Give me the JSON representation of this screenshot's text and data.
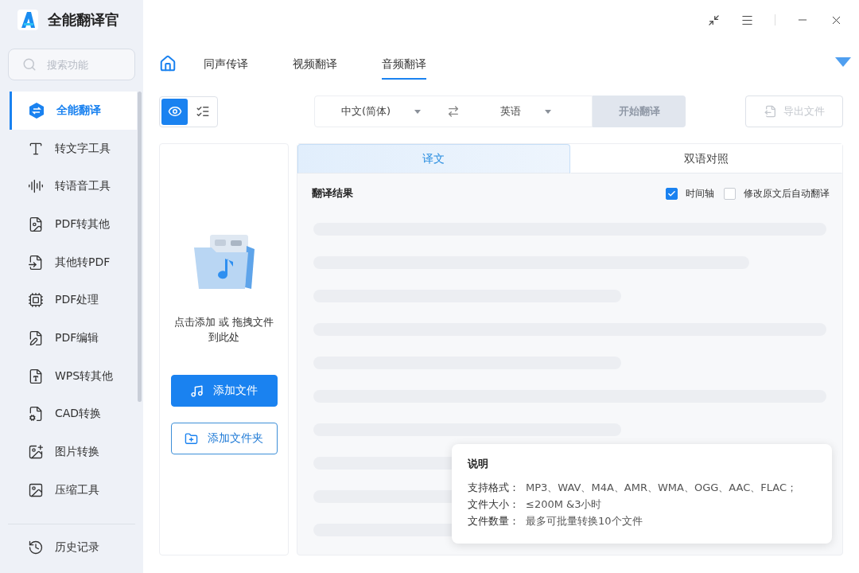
{
  "app": {
    "title": "全能翻译官"
  },
  "sidebar": {
    "search": {
      "placeholder": "搜索功能"
    },
    "items": [
      {
        "label": "全能翻译",
        "selected": true
      },
      {
        "label": "转文字工具",
        "selected": false
      },
      {
        "label": "转语音工具",
        "selected": false
      },
      {
        "label": "PDF转其他",
        "selected": false
      },
      {
        "label": "其他转PDF",
        "selected": false
      },
      {
        "label": "PDF处理",
        "selected": false
      },
      {
        "label": "PDF编辑",
        "selected": false
      },
      {
        "label": "WPS转其他",
        "selected": false
      },
      {
        "label": "CAD转换",
        "selected": false
      },
      {
        "label": "图片转换",
        "selected": false
      },
      {
        "label": "压缩工具",
        "selected": false
      }
    ],
    "footer_item": {
      "label": "历史记录"
    }
  },
  "nav_tabs": [
    {
      "label": "同声传译",
      "selected": false
    },
    {
      "label": "视频翻译",
      "selected": false
    },
    {
      "label": "音频翻译",
      "selected": true
    }
  ],
  "view_toggle": [
    {
      "selected": true
    },
    {
      "selected": false
    }
  ],
  "language_bar": {
    "source": "中文(简体)",
    "target": "英语",
    "start_button": {
      "label": "开始翻译",
      "disabled": true
    }
  },
  "export_button": {
    "label": "导出文件",
    "disabled": true
  },
  "upload_panel": {
    "hint": "点击添加 或 拖拽文件到此处",
    "buttons": [
      {
        "label": "添加文件",
        "kind": "primary"
      },
      {
        "label": "添加文件夹",
        "kind": "outline"
      }
    ]
  },
  "result_panel": {
    "tabs": [
      {
        "label": "译文",
        "selected": true
      },
      {
        "label": "双语对照",
        "selected": false
      }
    ],
    "title": "翻译结果",
    "options": [
      {
        "label": "时间轴",
        "checked": true
      },
      {
        "label": "修改原文后自动翻译",
        "checked": false
      }
    ]
  },
  "info_popup": {
    "title": "说明",
    "rows": [
      {
        "label": "支持格式：",
        "value": "MP3、WAV、M4A、AMR、WMA、OGG、AAC、FLAC；"
      },
      {
        "label": "文件大小：",
        "value": "≤200M &3小时"
      },
      {
        "label": "文件数量：",
        "value": "最多可批量转换10个文件"
      }
    ]
  }
}
